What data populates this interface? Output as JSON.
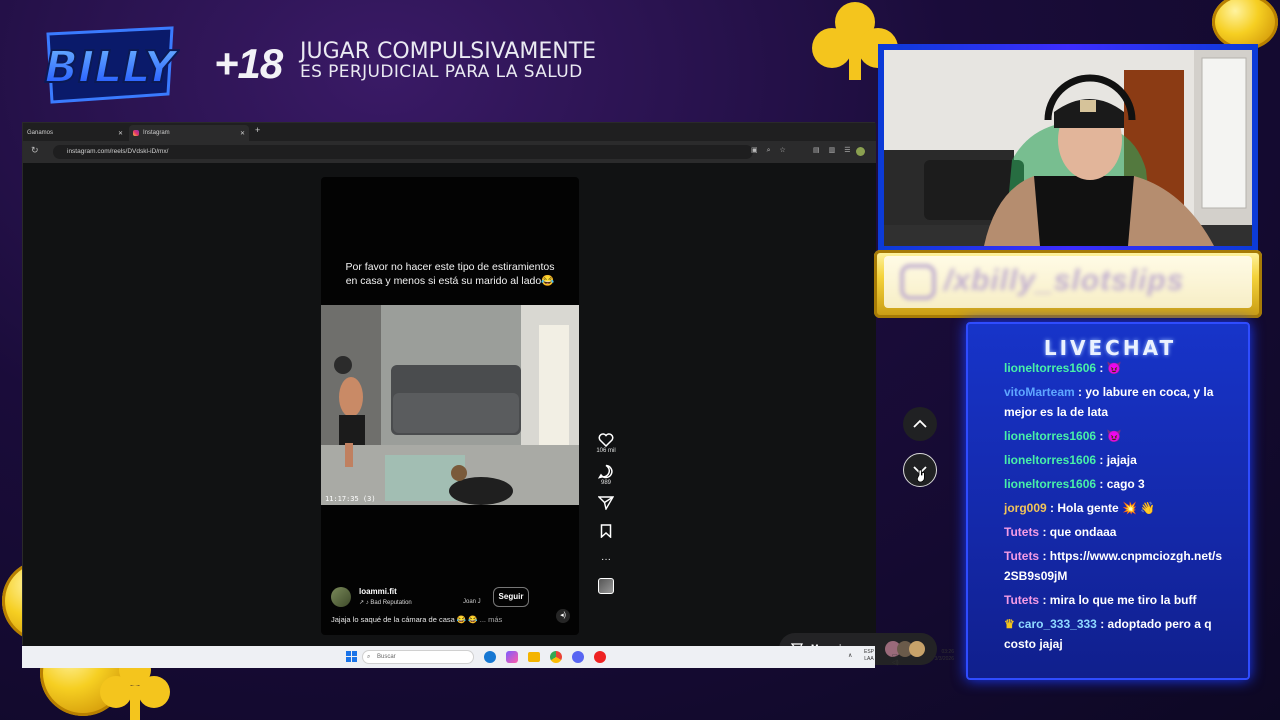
{
  "overlay": {
    "logo_text": "BILLY",
    "age_badge": "+18",
    "warning_line1": "JUGAR COMPULSIVAMENTE",
    "warning_line2": "ES PERJUDICIAL PARA LA SALUD"
  },
  "browser": {
    "tabs": [
      {
        "label": "Ganamos",
        "active": false
      },
      {
        "label": "Instagram",
        "active": true
      }
    ],
    "new_tab": "+",
    "url": "instagram.com/reels/DVdskl-iD/mx/"
  },
  "reel": {
    "caption": "Por favor no hacer este tipo de estiramientos en casa y menos si está su marido al lado😂",
    "video_timestamp": "11:17:35  (3)",
    "author": "loammi.fit",
    "music": "Bad Reputation",
    "music_artist": "Joan J",
    "follow_label": "Seguir",
    "description": "Jajaja lo saqué de la cámara de casa 😂 😂",
    "more_label": "... más",
    "likes": "106 mil",
    "comments": "989"
  },
  "messages_button": {
    "label": "Mensajes"
  },
  "taskbar": {
    "search_placeholder": "Buscar",
    "lang_line1": "ESP",
    "lang_line2": "LAA",
    "time": "03:26",
    "date": "3/3/2026"
  },
  "webcam": {
    "instagram_handle": "/xbilly_slotslips"
  },
  "chat": {
    "title": "LIVECHAT",
    "messages": [
      {
        "user": "lioneltorres1606",
        "text": "😈"
      },
      {
        "user": "vitoMarteam",
        "text": "yo labure en coca, y la mejor es la de lata"
      },
      {
        "user": "lioneltorres1606",
        "text": "😈"
      },
      {
        "user": "lioneltorres1606",
        "text": "jajaja"
      },
      {
        "user": "lioneltorres1606",
        "text": "cago 3"
      },
      {
        "user": "jorg009",
        "text": "Hola gente 💥 👋"
      },
      {
        "user": "Tutets",
        "text": "que ondaaa"
      },
      {
        "user": "Tutets",
        "text": "https://www.cnpmciozgh.net/s2SB9s09jM"
      },
      {
        "user": "Tutets",
        "text": "mira lo que me tiro la buff"
      },
      {
        "user": "caro_333_333",
        "text": "adoptado pero a q costo jajaj"
      }
    ]
  },
  "colors": {
    "chat_bg": "#1734c9",
    "gold": "#f4c51d",
    "user_lionel": "#48f0a8",
    "user_vito": "#5fa6ff",
    "user_jorg": "#f1c45a",
    "user_tutets": "#f39be4"
  }
}
